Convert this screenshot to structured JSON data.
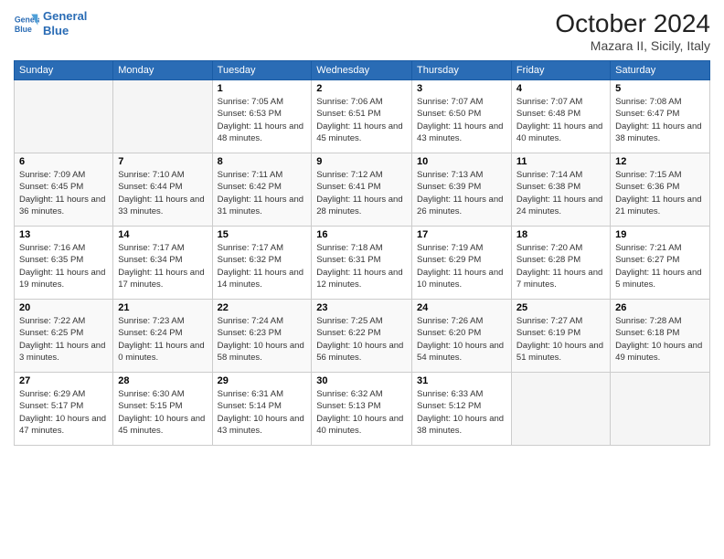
{
  "header": {
    "logo_line1": "General",
    "logo_line2": "Blue",
    "month": "October 2024",
    "location": "Mazara II, Sicily, Italy"
  },
  "weekdays": [
    "Sunday",
    "Monday",
    "Tuesday",
    "Wednesday",
    "Thursday",
    "Friday",
    "Saturday"
  ],
  "weeks": [
    [
      {
        "day": "",
        "info": ""
      },
      {
        "day": "",
        "info": ""
      },
      {
        "day": "1",
        "info": "Sunrise: 7:05 AM\nSunset: 6:53 PM\nDaylight: 11 hours and 48 minutes."
      },
      {
        "day": "2",
        "info": "Sunrise: 7:06 AM\nSunset: 6:51 PM\nDaylight: 11 hours and 45 minutes."
      },
      {
        "day": "3",
        "info": "Sunrise: 7:07 AM\nSunset: 6:50 PM\nDaylight: 11 hours and 43 minutes."
      },
      {
        "day": "4",
        "info": "Sunrise: 7:07 AM\nSunset: 6:48 PM\nDaylight: 11 hours and 40 minutes."
      },
      {
        "day": "5",
        "info": "Sunrise: 7:08 AM\nSunset: 6:47 PM\nDaylight: 11 hours and 38 minutes."
      }
    ],
    [
      {
        "day": "6",
        "info": "Sunrise: 7:09 AM\nSunset: 6:45 PM\nDaylight: 11 hours and 36 minutes."
      },
      {
        "day": "7",
        "info": "Sunrise: 7:10 AM\nSunset: 6:44 PM\nDaylight: 11 hours and 33 minutes."
      },
      {
        "day": "8",
        "info": "Sunrise: 7:11 AM\nSunset: 6:42 PM\nDaylight: 11 hours and 31 minutes."
      },
      {
        "day": "9",
        "info": "Sunrise: 7:12 AM\nSunset: 6:41 PM\nDaylight: 11 hours and 28 minutes."
      },
      {
        "day": "10",
        "info": "Sunrise: 7:13 AM\nSunset: 6:39 PM\nDaylight: 11 hours and 26 minutes."
      },
      {
        "day": "11",
        "info": "Sunrise: 7:14 AM\nSunset: 6:38 PM\nDaylight: 11 hours and 24 minutes."
      },
      {
        "day": "12",
        "info": "Sunrise: 7:15 AM\nSunset: 6:36 PM\nDaylight: 11 hours and 21 minutes."
      }
    ],
    [
      {
        "day": "13",
        "info": "Sunrise: 7:16 AM\nSunset: 6:35 PM\nDaylight: 11 hours and 19 minutes."
      },
      {
        "day": "14",
        "info": "Sunrise: 7:17 AM\nSunset: 6:34 PM\nDaylight: 11 hours and 17 minutes."
      },
      {
        "day": "15",
        "info": "Sunrise: 7:17 AM\nSunset: 6:32 PM\nDaylight: 11 hours and 14 minutes."
      },
      {
        "day": "16",
        "info": "Sunrise: 7:18 AM\nSunset: 6:31 PM\nDaylight: 11 hours and 12 minutes."
      },
      {
        "day": "17",
        "info": "Sunrise: 7:19 AM\nSunset: 6:29 PM\nDaylight: 11 hours and 10 minutes."
      },
      {
        "day": "18",
        "info": "Sunrise: 7:20 AM\nSunset: 6:28 PM\nDaylight: 11 hours and 7 minutes."
      },
      {
        "day": "19",
        "info": "Sunrise: 7:21 AM\nSunset: 6:27 PM\nDaylight: 11 hours and 5 minutes."
      }
    ],
    [
      {
        "day": "20",
        "info": "Sunrise: 7:22 AM\nSunset: 6:25 PM\nDaylight: 11 hours and 3 minutes."
      },
      {
        "day": "21",
        "info": "Sunrise: 7:23 AM\nSunset: 6:24 PM\nDaylight: 11 hours and 0 minutes."
      },
      {
        "day": "22",
        "info": "Sunrise: 7:24 AM\nSunset: 6:23 PM\nDaylight: 10 hours and 58 minutes."
      },
      {
        "day": "23",
        "info": "Sunrise: 7:25 AM\nSunset: 6:22 PM\nDaylight: 10 hours and 56 minutes."
      },
      {
        "day": "24",
        "info": "Sunrise: 7:26 AM\nSunset: 6:20 PM\nDaylight: 10 hours and 54 minutes."
      },
      {
        "day": "25",
        "info": "Sunrise: 7:27 AM\nSunset: 6:19 PM\nDaylight: 10 hours and 51 minutes."
      },
      {
        "day": "26",
        "info": "Sunrise: 7:28 AM\nSunset: 6:18 PM\nDaylight: 10 hours and 49 minutes."
      }
    ],
    [
      {
        "day": "27",
        "info": "Sunrise: 6:29 AM\nSunset: 5:17 PM\nDaylight: 10 hours and 47 minutes."
      },
      {
        "day": "28",
        "info": "Sunrise: 6:30 AM\nSunset: 5:15 PM\nDaylight: 10 hours and 45 minutes."
      },
      {
        "day": "29",
        "info": "Sunrise: 6:31 AM\nSunset: 5:14 PM\nDaylight: 10 hours and 43 minutes."
      },
      {
        "day": "30",
        "info": "Sunrise: 6:32 AM\nSunset: 5:13 PM\nDaylight: 10 hours and 40 minutes."
      },
      {
        "day": "31",
        "info": "Sunrise: 6:33 AM\nSunset: 5:12 PM\nDaylight: 10 hours and 38 minutes."
      },
      {
        "day": "",
        "info": ""
      },
      {
        "day": "",
        "info": ""
      }
    ]
  ]
}
